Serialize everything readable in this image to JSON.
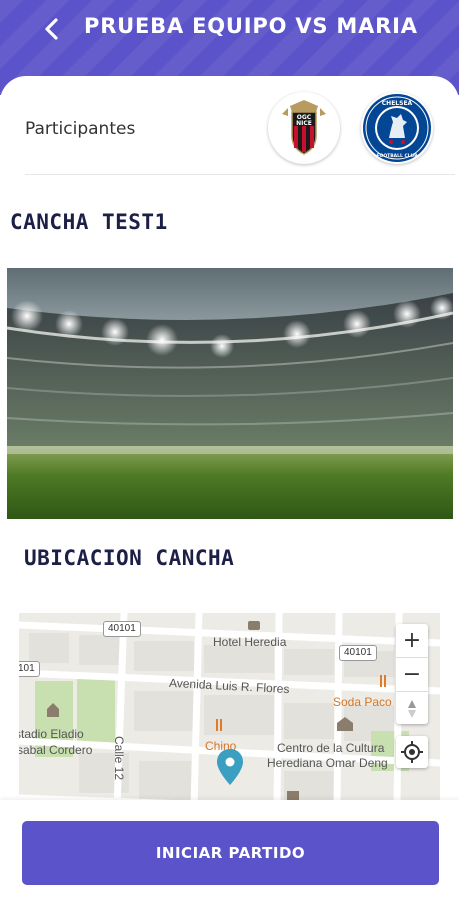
{
  "header": {
    "title": "PRUEBA EQUIPO VS MARIA",
    "back_icon": "chevron-left-icon"
  },
  "participants": {
    "label": "Participantes",
    "teams": [
      {
        "name": "OGC Nice",
        "badge_text_top": "OGC",
        "badge_text_bottom": "NICE",
        "icon": "team-crest-icon"
      },
      {
        "name": "Chelsea Football Club",
        "badge_text_top": "CHELSEA",
        "badge_text_bottom": "FOOTBALL CLUB",
        "icon": "team-crest-icon"
      }
    ]
  },
  "venue": {
    "title": "CANCHA TEST1",
    "image_alt": "stadium-photo"
  },
  "location": {
    "title": "UBICACION CANCHA",
    "map": {
      "labels": [
        "Hotel Heredia",
        "Avenida Luis R. Flores",
        "Soda Paco",
        "stadio Eladio",
        "sabal Cordero",
        "Calle 12",
        "Chino",
        "Centro de la Cultura",
        "Herediana Omar Deng"
      ],
      "road_badges": [
        "40101",
        "40101",
        "101"
      ],
      "controls": {
        "zoom_in": "+",
        "zoom_out": "−"
      }
    }
  },
  "actions": {
    "start_label": "INICIAR PARTIDO"
  },
  "colors": {
    "primary": "#5b53c9",
    "heading": "#1c1f46"
  }
}
